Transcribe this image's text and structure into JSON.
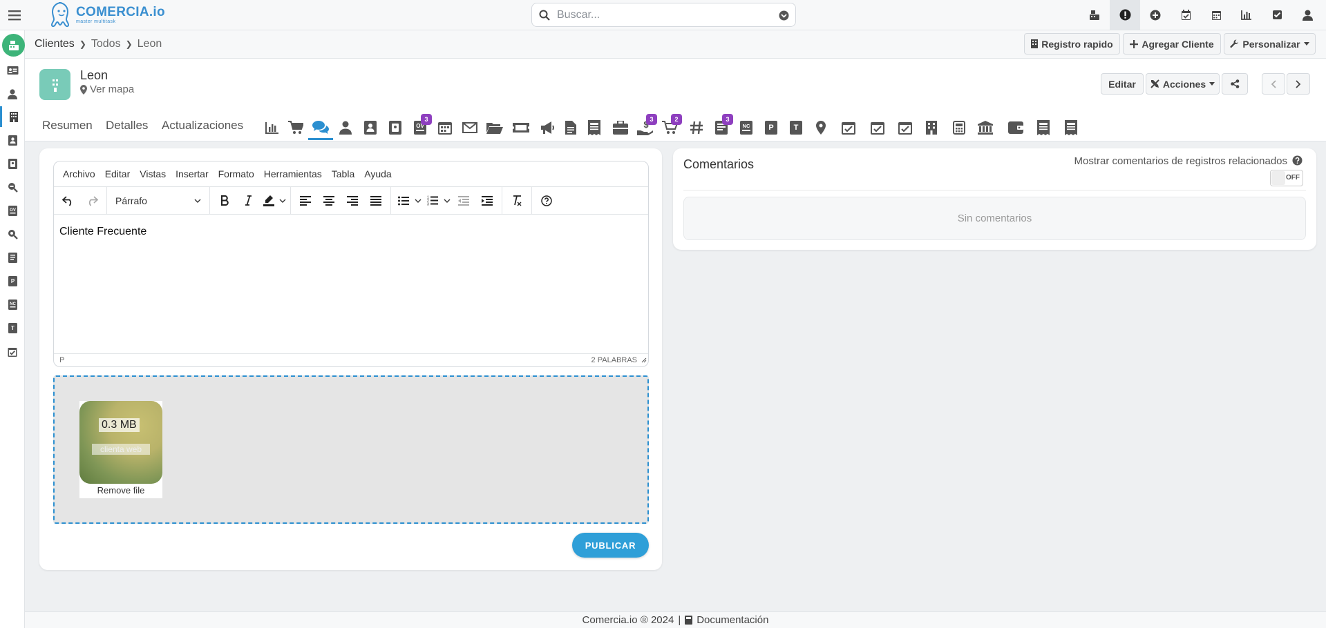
{
  "search": {
    "placeholder": "Buscar..."
  },
  "logo": {
    "name": "COMERCIA.io",
    "tagline": "master multitask"
  },
  "topbar_icons": [
    "cash-register-icon",
    "alert-icon",
    "plus-circle-icon",
    "calendar-check-icon",
    "calendar-icon",
    "bar-chart-icon",
    "checkbox-icon",
    "user-icon"
  ],
  "breadcrumb": {
    "root": "Clientes",
    "level1": "Todos",
    "current": "Leon"
  },
  "header_buttons": {
    "quick": "Registro rapido",
    "add": "Agregar Cliente",
    "customize": "Personalizar"
  },
  "record": {
    "name": "Leon",
    "map_link": "Ver mapa"
  },
  "record_buttons": {
    "edit": "Editar",
    "actions": "Acciones"
  },
  "tabs": {
    "summary": "Resumen",
    "details": "Detalles",
    "updates": "Actualizaciones"
  },
  "tab_badges": {
    "quotes": "3",
    "payments": "3",
    "cart": "2",
    "invoices": "3"
  },
  "editor": {
    "menu": [
      "Archivo",
      "Editar",
      "Vistas",
      "Insertar",
      "Formato",
      "Herramientas",
      "Tabla",
      "Ayuda"
    ],
    "block_format": "Párrafo",
    "content": "Cliente Frecuente",
    "status_path": "P",
    "word_count": "2 PALABRAS"
  },
  "upload": {
    "size": "0.3 MB",
    "filename": "clienta web",
    "remove": "Remove file"
  },
  "publish_label": "PUBLICAR",
  "comments": {
    "title": "Comentarios",
    "related_label": "Mostrar comentarios de registros relacionados",
    "toggle_state": "OFF",
    "empty": "Sin comentarios"
  },
  "footer": {
    "copyright": "Comercia.io ® 2024",
    "separator": "|",
    "docs": "Documentación"
  },
  "colors": {
    "accent": "#2b8fd0",
    "publish": "#2f9fd8",
    "home": "#3db479",
    "avatar": "#79cbb8",
    "badge": "#8e3fbf"
  }
}
